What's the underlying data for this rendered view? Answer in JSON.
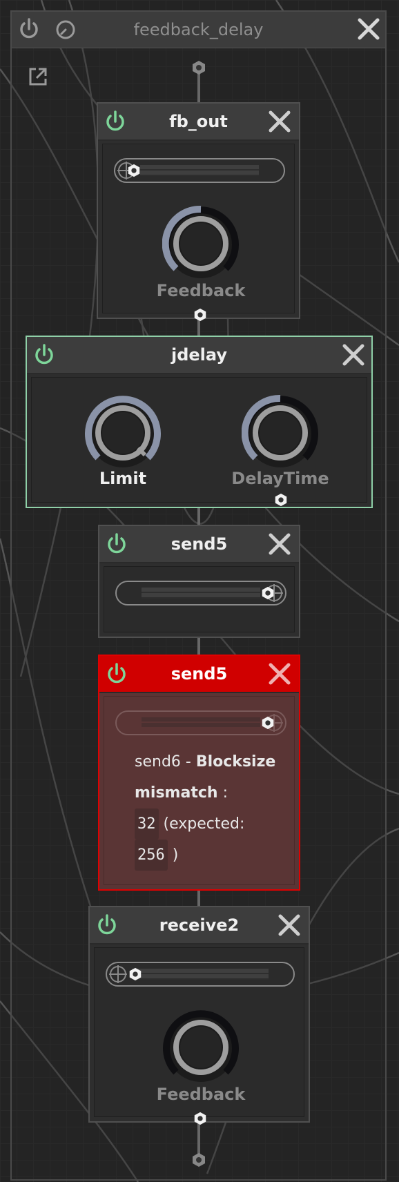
{
  "outer": {
    "title": "feedback_delay"
  },
  "modules": {
    "fb_out": {
      "title": "fb_out",
      "knob_label": "Feedback"
    },
    "jdelay": {
      "title": "jdelay",
      "knob1_label": "Limit",
      "knob2_label": "DelayTime"
    },
    "send5_a": {
      "title": "send5"
    },
    "send5_b": {
      "title": "send5",
      "error": {
        "line1_prefix": "send6 -",
        "line1_bold": "Blocksize",
        "line2_bold": "mismatch",
        "line2_suffix": ":",
        "value": "32",
        "expected_label": "(expected:",
        "expected_value": "256",
        "close_paren": ")"
      }
    },
    "receive2": {
      "title": "receive2",
      "knob_label": "Feedback"
    }
  },
  "colors": {
    "power_green": "#7ed69a",
    "error_red": "#d00000",
    "selected_border": "#8fd0a8",
    "knob_arc": "#8a93a8"
  },
  "icons": {
    "power": "power-icon",
    "close": "close-icon",
    "gauge": "gauge-icon",
    "external": "external-link-icon",
    "port": "port-icon"
  }
}
